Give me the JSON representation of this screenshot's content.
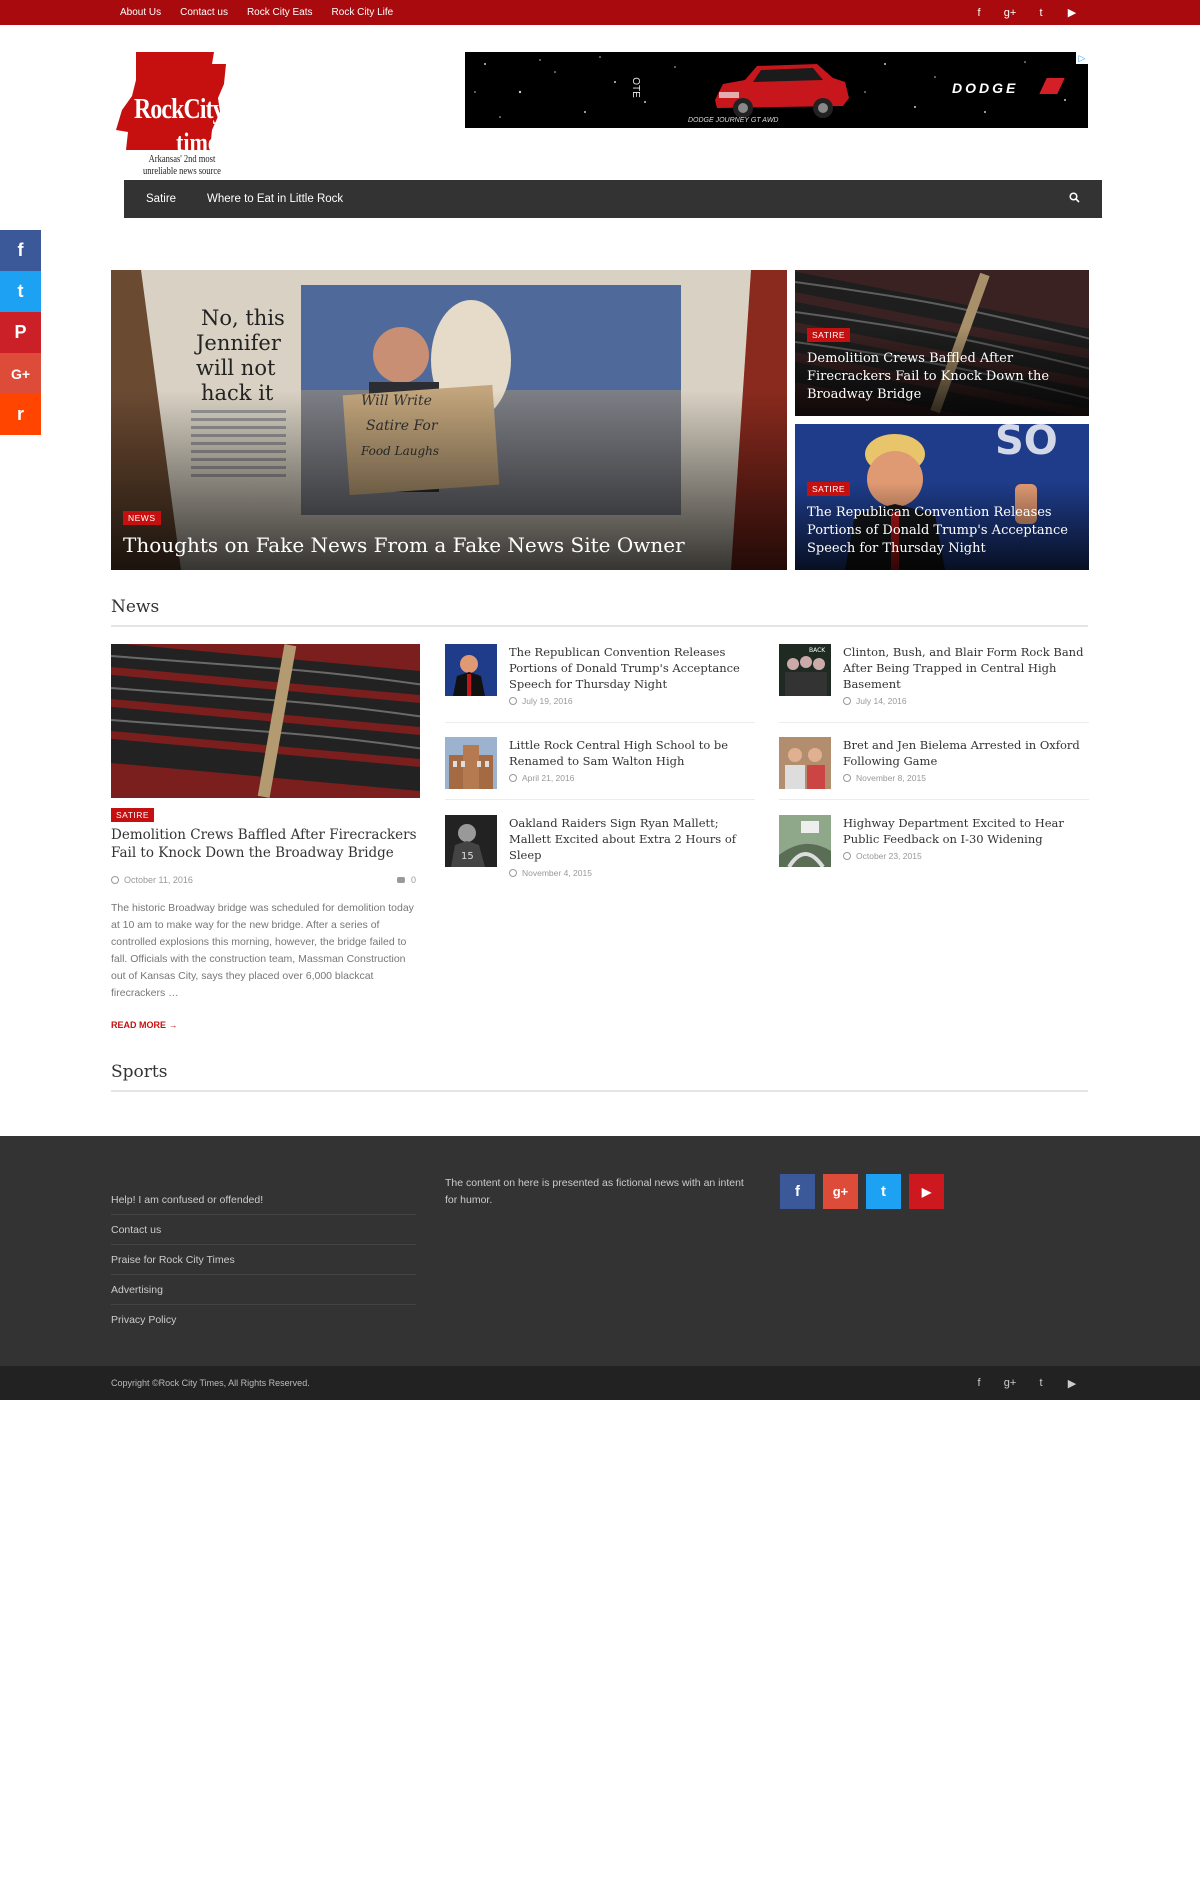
{
  "topbar": {
    "links": [
      "About Us",
      "Contact us",
      "Rock City Eats",
      "Rock City Life"
    ],
    "social_icons": [
      "facebook-icon",
      "google-plus-icon",
      "twitter-icon",
      "youtube-icon"
    ],
    "social_glyphs": [
      "f",
      "g+",
      "t",
      "▶"
    ]
  },
  "logo": {
    "line1": "RockCity",
    "line2": "times",
    "tagline": "Arkansas' 2nd most unreliable news source"
  },
  "ad": {
    "brand": "DODGE",
    "model": "DODGE JOURNEY GT AWD",
    "left_text": "OTE"
  },
  "nav": {
    "items": [
      "Satire",
      "Where to Eat in Little Rock"
    ]
  },
  "share_bar": [
    {
      "icon": "facebook-icon",
      "glyph": "f",
      "color": "#3b5998"
    },
    {
      "icon": "twitter-icon",
      "glyph": "t",
      "color": "#1da1f2"
    },
    {
      "icon": "pinterest-icon",
      "glyph": "P",
      "color": "#cb2027"
    },
    {
      "icon": "google-plus-icon",
      "glyph": "G+",
      "color": "#dd4b39"
    },
    {
      "icon": "reddit-icon",
      "glyph": "r",
      "color": "#ff4500"
    }
  ],
  "hero": {
    "main": {
      "badge": "NEWS",
      "title": "Thoughts on Fake News From a Fake News Site Owner"
    },
    "side": [
      {
        "badge": "SATIRE",
        "title": "Demolition Crews Baffled After Firecrackers Fail to Knock Down the Broadway Bridge"
      },
      {
        "badge": "SATIRE",
        "title": "The Republican Convention Releases Portions of Donald Trump's Acceptance Speech for Thursday Night"
      }
    ],
    "newspaper_headline": "No, this Jennifer will not hack it",
    "sign_text": "Will Write Satire For Food Laughs"
  },
  "news": {
    "heading": "News",
    "feature": {
      "badge": "SATIRE",
      "title": "Demolition Crews Baffled After Firecrackers Fail to Knock Down the Broadway Bridge",
      "date": "October 11, 2016",
      "comments": "0",
      "excerpt": "The historic Broadway bridge was scheduled for demolition today at 10 am to make way for the new bridge. After a series of controlled explosions this morning, however, the bridge failed to fall. Officials with the construction team, Massman Construction out of Kansas City, says they placed over 6,000 blackcat firecrackers …",
      "read_more": "READ MORE →"
    },
    "col2": [
      {
        "title": "The Republican Convention Releases Portions of Donald Trump's Acceptance Speech for Thursday Night",
        "date": "July 19, 2016"
      },
      {
        "title": "Little Rock Central High School to be Renamed to Sam Walton High",
        "date": "April 21, 2016"
      },
      {
        "title": "Oakland Raiders Sign Ryan Mallett; Mallett Excited about Extra 2 Hours of Sleep",
        "date": "November 4, 2015"
      }
    ],
    "col3": [
      {
        "title": "Clinton, Bush, and Blair Form Rock Band After Being Trapped in Central High Basement",
        "date": "July 14, 2016"
      },
      {
        "title": "Bret and Jen Bielema Arrested in Oxford Following Game",
        "date": "November 8, 2015"
      },
      {
        "title": "Highway Department Excited to Hear Public Feedback on I-30 Widening",
        "date": "October 23, 2015"
      }
    ]
  },
  "sports": {
    "heading": "Sports"
  },
  "footer": {
    "links": [
      "Help! I am confused or offended!",
      "Contact us",
      "Praise for Rock City Times",
      "Advertising",
      "Privacy Policy"
    ],
    "about": "The content on here is presented as fictional news with an intent for humor.",
    "social": [
      {
        "icon": "facebook-icon",
        "glyph": "f",
        "color": "#3b5998"
      },
      {
        "icon": "google-plus-icon",
        "glyph": "g+",
        "color": "#dd4b39"
      },
      {
        "icon": "twitter-icon",
        "glyph": "t",
        "color": "#1da1f2"
      },
      {
        "icon": "youtube-icon",
        "glyph": "▶",
        "color": "#cc181e"
      }
    ],
    "copyright": "Copyright ©Rock City Times, All Rights Reserved."
  },
  "colors": {
    "accent": "#a80a0d",
    "badge": "#c5100f",
    "nav": "#333333",
    "footer": "#333333",
    "bottombar": "#222222"
  }
}
